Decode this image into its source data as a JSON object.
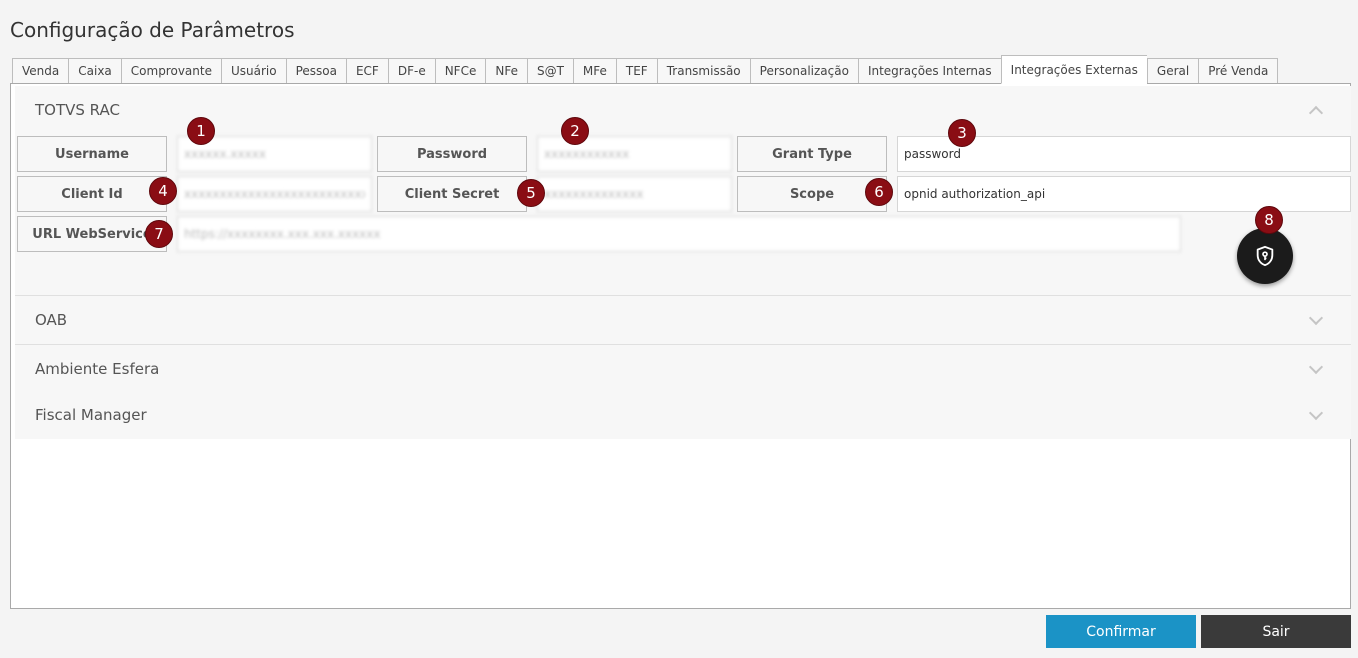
{
  "page_title": "Configuração de Parâmetros",
  "tabs": [
    "Venda",
    "Caixa",
    "Comprovante",
    "Usuário",
    "Pessoa",
    "ECF",
    "DF-e",
    "NFCe",
    "NFe",
    "S@T",
    "MFe",
    "TEF",
    "Transmissão",
    "Personalização",
    "Integrações Internas",
    "Integrações Externas",
    "Geral",
    "Pré Venda"
  ],
  "active_tab": "Integrações Externas",
  "sections": {
    "totvs_rac": "TOTVS RAC",
    "oab": "OAB",
    "ambiente_esfera": "Ambiente Esfera",
    "fiscal_manager": "Fiscal Manager"
  },
  "fields": {
    "username": {
      "label": "Username",
      "value": "xxxxxx.xxxxx"
    },
    "password": {
      "label": "Password",
      "value": "xxxxxxxxxxxx"
    },
    "grant_type": {
      "label": "Grant Type",
      "value": "password"
    },
    "client_id": {
      "label": "Client Id",
      "value": "xxxxxxxxxxxxxxxxxxxxxxxxxxxxxxxx"
    },
    "client_secret": {
      "label": "Client Secret",
      "value": "xxxxxxxxxxxxxx"
    },
    "scope": {
      "label": "Scope",
      "value": "opnid authorization_api"
    },
    "url_webservice": {
      "label": "URL WebService",
      "value": "https://xxxxxxxx.xxx.xxx.xxxxxx"
    }
  },
  "markers": [
    "1",
    "2",
    "3",
    "4",
    "5",
    "6",
    "7",
    "8"
  ],
  "buttons": {
    "confirm": "Confirmar",
    "exit": "Sair"
  },
  "icons": {
    "fab": "shield-key-icon",
    "expanded": "chevron-up-icon",
    "collapsed": "chevron-down-icon"
  },
  "colors": {
    "confirm": "#1b93c6",
    "exit": "#3a3a3a",
    "marker": "#8a0d14",
    "fab": "#1b1b1b"
  }
}
